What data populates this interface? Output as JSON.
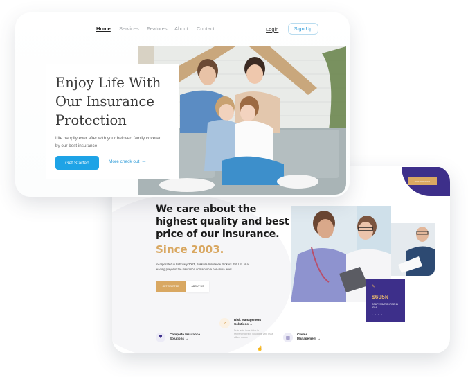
{
  "top_page": {
    "nav": {
      "items": [
        {
          "label": "Home",
          "active": true
        },
        {
          "label": "Services",
          "active": false
        },
        {
          "label": "Features",
          "active": false
        },
        {
          "label": "About",
          "active": false
        },
        {
          "label": "Contact",
          "active": false
        }
      ],
      "login_label": "Login",
      "signup_label": "Sign Up"
    },
    "hero": {
      "title": "Enjoy Life With Our Insurance Protection",
      "subtitle": "Life happily ever after with your beloved family covered by our best insurance",
      "primary_button": "Get Started",
      "secondary_link": "More check out",
      "arrow": "→",
      "image_description": "family-under-cardboard-roof-on-sofa"
    }
  },
  "bottom_page": {
    "heading": "We care about the highest quality and best price of our insurance.",
    "since": "Since 2003.",
    "description": "Incorporated in February 2003, Suskaila Insurance Brokers Pvt. Ltd. is a leading player in the insurance domain on a pan-India level.",
    "buttons": {
      "primary": "GET STARTED",
      "secondary": "ABOUT US"
    },
    "corner_button": "OUR SERVICES",
    "stat": {
      "icon": "pen-icon",
      "value": "$695k",
      "label": "COMPENSATION PAID IN 2024",
      "dots": "• • • •"
    },
    "features": [
      {
        "icon": "shield-icon",
        "title": "Complete Insurance Solutions →",
        "description": ""
      },
      {
        "icon": "chart-up-icon",
        "title": "Risk Management Solutions →",
        "description": "Duis aute irure dolor in reprehenderit in voluptate velit esse cillum dolore"
      },
      {
        "icon": "document-icon",
        "title": "Claims Management →",
        "description": ""
      }
    ],
    "colors": {
      "purple": "#3d2f8a",
      "gold": "#d9a862",
      "blue": "#1ea3e6"
    }
  }
}
